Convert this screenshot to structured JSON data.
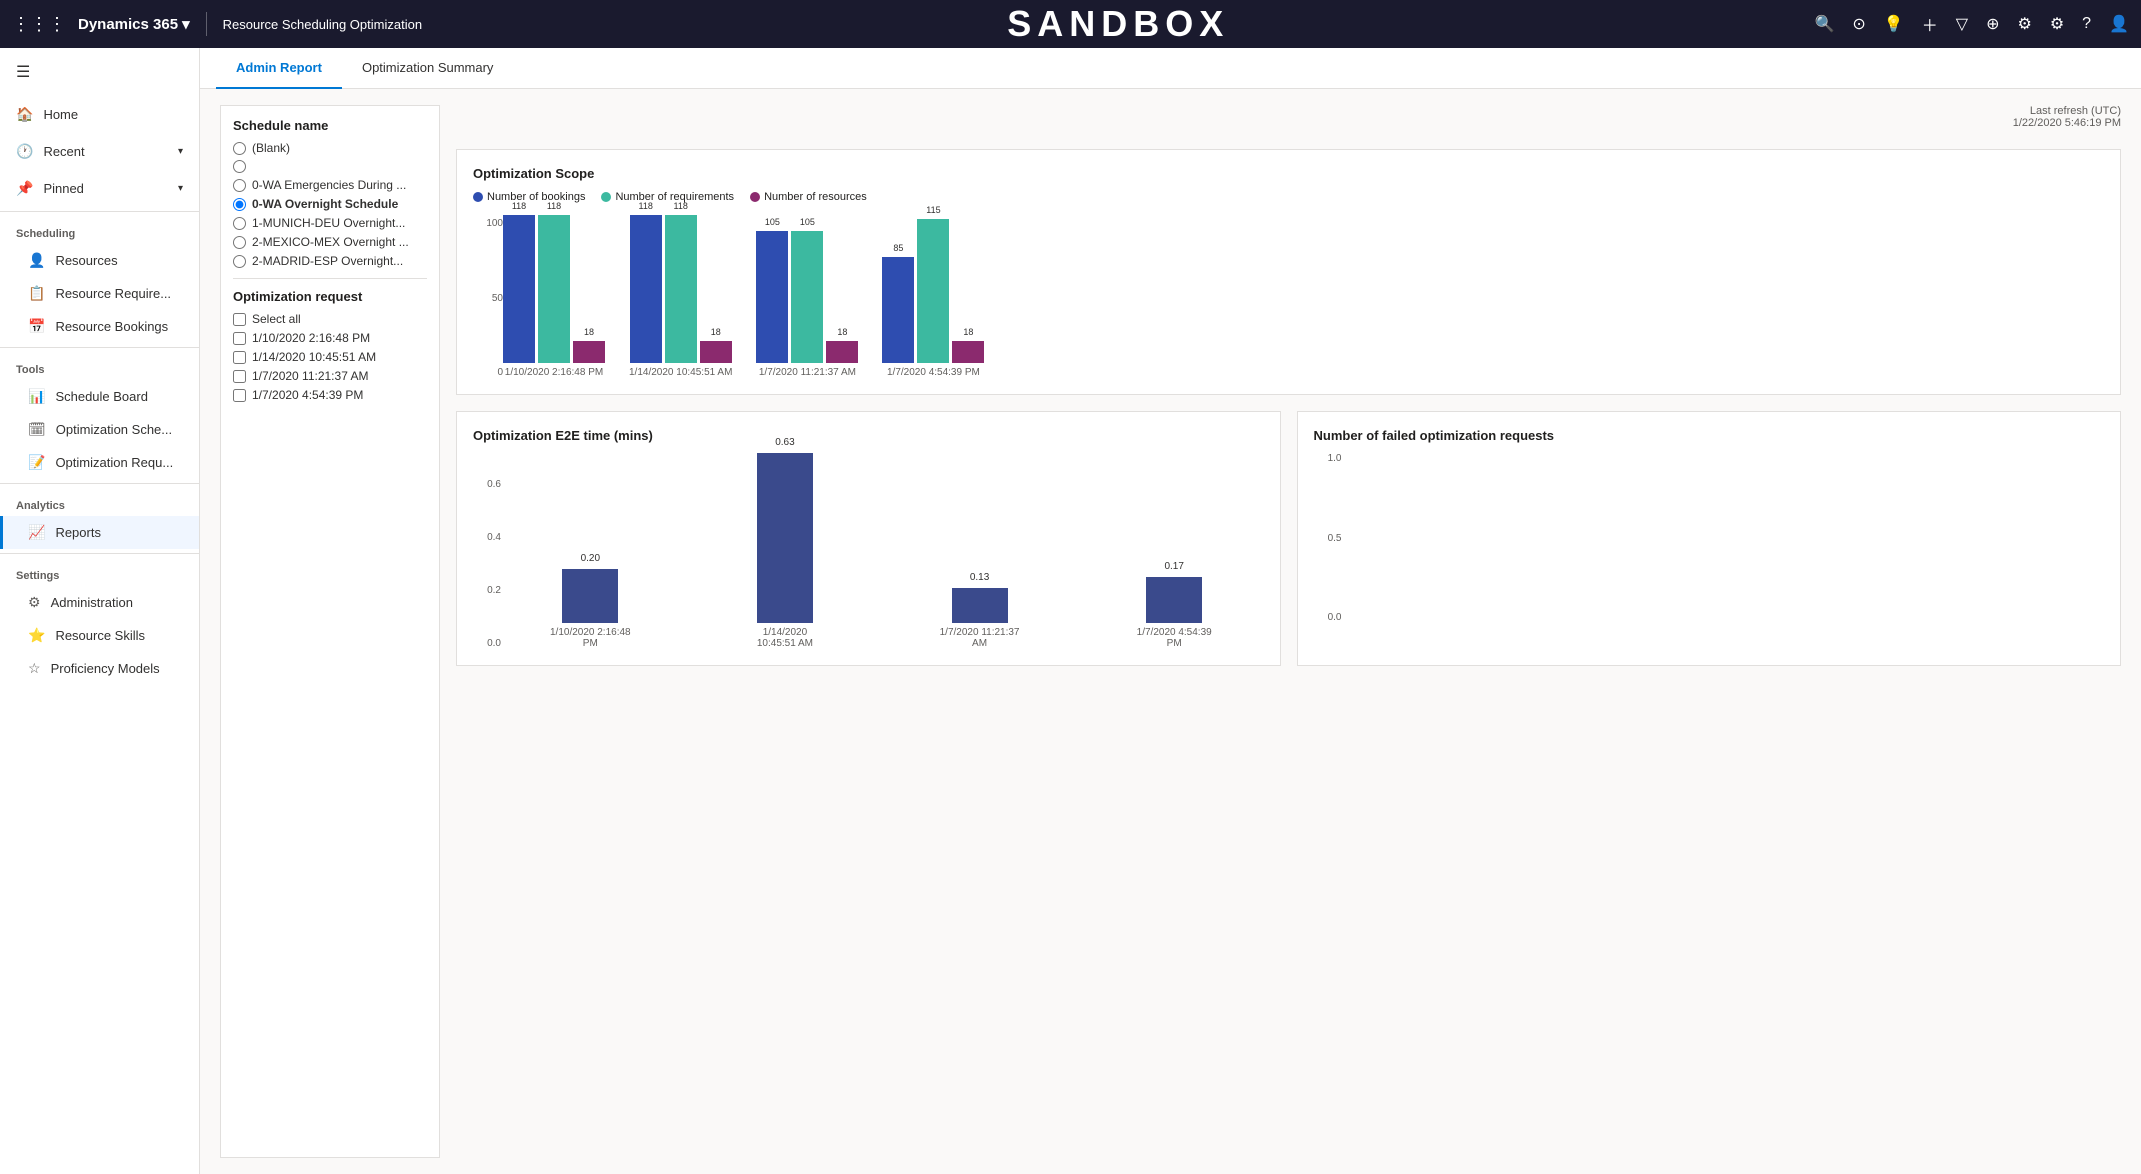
{
  "topNav": {
    "waffle": "⋮⋮⋮",
    "brand": "Dynamics 365",
    "brandArrow": "▾",
    "appTitle": "Resource Scheduling Optimization",
    "sandbox": "SANDBOX",
    "icons": [
      "🔍",
      "✓○",
      "💡",
      "+",
      "▽",
      "⊕",
      "⚙",
      "⚙",
      "?",
      "👤"
    ]
  },
  "sidebar": {
    "hamburger": "☰",
    "topItems": [
      {
        "label": "Home",
        "icon": "🏠",
        "arrow": ""
      },
      {
        "label": "Recent",
        "icon": "🕐",
        "arrow": "▾"
      },
      {
        "label": "Pinned",
        "icon": "📌",
        "arrow": "▾"
      }
    ],
    "groups": [
      {
        "label": "Scheduling",
        "items": [
          {
            "label": "Resources",
            "icon": "👤",
            "active": false
          },
          {
            "label": "Resource Require...",
            "icon": "📋",
            "active": false
          },
          {
            "label": "Resource Bookings",
            "icon": "📅",
            "active": false
          }
        ]
      },
      {
        "label": "Tools",
        "items": [
          {
            "label": "Schedule Board",
            "icon": "📊",
            "active": false
          },
          {
            "label": "Optimization Sche...",
            "icon": "🗓",
            "active": false
          },
          {
            "label": "Optimization Requ...",
            "icon": "📝",
            "active": false
          }
        ]
      },
      {
        "label": "Analytics",
        "items": [
          {
            "label": "Reports",
            "icon": "📈",
            "active": true
          }
        ]
      },
      {
        "label": "Settings",
        "items": [
          {
            "label": "Administration",
            "icon": "⚙",
            "active": false
          },
          {
            "label": "Resource Skills",
            "icon": "⭐",
            "active": false
          },
          {
            "label": "Proficiency Models",
            "icon": "☆",
            "active": false
          }
        ]
      }
    ]
  },
  "tabs": [
    {
      "label": "Admin Report",
      "active": true
    },
    {
      "label": "Optimization Summary",
      "active": false
    }
  ],
  "filters": {
    "scheduleNameTitle": "Schedule name",
    "scheduleOptions": [
      {
        "label": "(Blank)",
        "selected": false
      },
      {
        "label": "",
        "selected": false
      },
      {
        "label": "0-WA Emergencies During ...",
        "selected": false
      },
      {
        "label": "0-WA Overnight Schedule",
        "selected": true
      },
      {
        "label": "1-MUNICH-DEU Overnight...",
        "selected": false
      },
      {
        "label": "2-MEXICO-MEX Overnight ...",
        "selected": false
      },
      {
        "label": "2-MADRID-ESP Overnight...",
        "selected": false
      }
    ],
    "optReqTitle": "Optimization request",
    "optReqOptions": [
      {
        "label": "Select all",
        "checked": false
      },
      {
        "label": "1/10/2020 2:16:48 PM",
        "checked": false
      },
      {
        "label": "1/14/2020 10:45:51 AM",
        "checked": false
      },
      {
        "label": "1/7/2020 11:21:37 AM",
        "checked": false
      },
      {
        "label": "1/7/2020 4:54:39 PM",
        "checked": false
      }
    ]
  },
  "refreshInfo": {
    "label": "Last refresh (UTC)",
    "value": "1/22/2020 5:46:19 PM"
  },
  "optimizationScope": {
    "title": "Optimization Scope",
    "legend": [
      {
        "label": "Number of bookings",
        "color": "#2e4db0"
      },
      {
        "label": "Number of requirements",
        "color": "#3cb9a0"
      },
      {
        "label": "Number of resources",
        "color": "#8b2a6e"
      }
    ],
    "yAxisLabels": [
      "100",
      "50",
      "0"
    ],
    "groups": [
      {
        "label": "1/10/2020 2:16:48 PM",
        "bars": [
          {
            "value": 118,
            "color": "#2e4db0",
            "heightPct": 92
          },
          {
            "value": 118,
            "color": "#3cb9a0",
            "heightPct": 92
          },
          {
            "value": 18,
            "color": "#8b2a6e",
            "heightPct": 14
          }
        ]
      },
      {
        "label": "1/14/2020 10:45:51 AM",
        "bars": [
          {
            "value": 118,
            "color": "#2e4db0",
            "heightPct": 92
          },
          {
            "value": 118,
            "color": "#3cb9a0",
            "heightPct": 92
          },
          {
            "value": 18,
            "color": "#8b2a6e",
            "heightPct": 14
          }
        ]
      },
      {
        "label": "1/7/2020 11:21:37 AM",
        "bars": [
          {
            "value": 105,
            "color": "#2e4db0",
            "heightPct": 82
          },
          {
            "value": 105,
            "color": "#3cb9a0",
            "heightPct": 82
          },
          {
            "value": 18,
            "color": "#8b2a6e",
            "heightPct": 14
          }
        ]
      },
      {
        "label": "1/7/2020 4:54:39 PM",
        "bars": [
          {
            "value": 85,
            "color": "#2e4db0",
            "heightPct": 66
          },
          {
            "value": 115,
            "color": "#3cb9a0",
            "heightPct": 90
          },
          {
            "value": 18,
            "color": "#8b2a6e",
            "heightPct": 14
          }
        ]
      }
    ]
  },
  "e2eChart": {
    "title": "Optimization E2E time (mins)",
    "yAxisLabels": [
      "0.6",
      "0.4",
      "0.2",
      "0.0"
    ],
    "groups": [
      {
        "label": "1/10/2020 2:16:48\nPM",
        "value": "0.20",
        "heightPct": 32
      },
      {
        "label": "1/14/2020\n10:45:51 AM",
        "value": "0.63",
        "heightPct": 100
      },
      {
        "label": "1/7/2020 11:21:37\nAM",
        "value": "0.13",
        "heightPct": 21
      },
      {
        "label": "1/7/2020 4:54:39\nPM",
        "value": "0.17",
        "heightPct": 27
      }
    ]
  },
  "failedChart": {
    "title": "Number of failed optimization requests",
    "yAxisLabels": [
      "1.0",
      "0.5",
      "0.0"
    ]
  }
}
